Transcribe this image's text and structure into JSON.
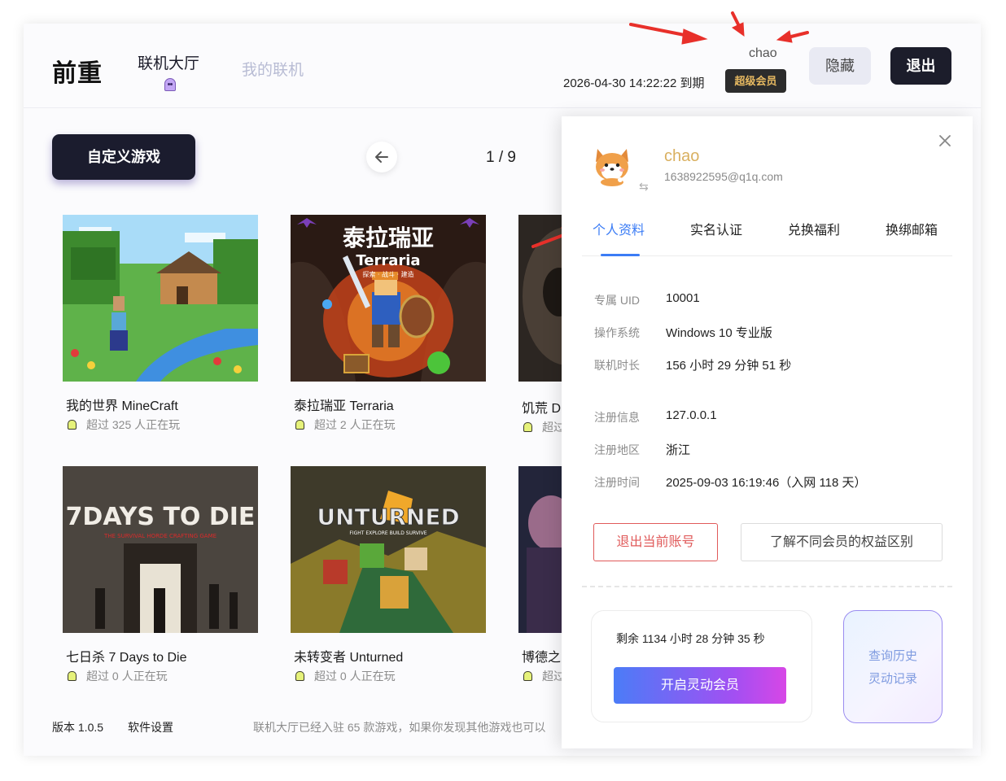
{
  "header": {
    "logo": "前重",
    "tabs": [
      {
        "label": "联机大厅"
      },
      {
        "label": "我的联机"
      }
    ],
    "username": "chao",
    "expire_text": "2026-04-30 14:22:22 到期",
    "vip_badge": "超级会员",
    "hide_label": "隐藏",
    "logout_label": "退出"
  },
  "toolbar": {
    "custom_game_label": "自定义游戏",
    "page_indicator": "1 / 9"
  },
  "games": [
    {
      "title": "我的世界 MineCraft",
      "players": "超过 325 人正在玩"
    },
    {
      "title": "泰拉瑞亚 Terraria",
      "players": "超过 2 人正在玩",
      "art_title": "泰拉瑞亚",
      "art_subtitle": "Terraria",
      "art_tagline": "探索 · 战斗 · 建造"
    },
    {
      "title": "饥荒 D",
      "players": "超过"
    },
    {
      "title": "七日杀 7 Days to Die",
      "players": "超过 0 人正在玩",
      "art_title": "7DAYS TO DIE",
      "art_tagline": "THE SURVIVAL HORDE CRAFTING GAME"
    },
    {
      "title": "未转变者 Unturned",
      "players": "超过 0 人正在玩",
      "art_title": "UNTURNED",
      "art_tagline": "FIGHT EXPLORE BUILD SURVIVE"
    },
    {
      "title": "博德之",
      "players": "超过"
    }
  ],
  "footer": {
    "version": "版本 1.0.5",
    "settings": "软件设置",
    "info": "联机大厅已经入驻 65 款游戏，如果你发现其他游戏也可以"
  },
  "profile": {
    "name": "chao",
    "email": "1638922595@q1q.com",
    "tabs": [
      {
        "label": "个人资料"
      },
      {
        "label": "实名认证"
      },
      {
        "label": "兑换福利"
      },
      {
        "label": "换绑邮箱"
      }
    ],
    "active_tab": "个人资料",
    "info": [
      {
        "label": "专属 UID",
        "value": "10001"
      },
      {
        "label": "操作系统",
        "value": "Windows 10 专业版"
      },
      {
        "label": "联机时长",
        "value": "156 小时 29 分钟 51 秒"
      },
      {
        "label": "注册信息",
        "value": "127.0.0.1"
      },
      {
        "label": "注册地区",
        "value": "浙江"
      },
      {
        "label": "注册时间",
        "value": "2025-09-03 16:19:46（入网 118 天）"
      }
    ],
    "logout_account_label": "退出当前账号",
    "benefits_label": "了解不同会员的权益区别",
    "remaining_text": "剩余 1134 小时 28 分钟 35 秒",
    "open_vip_label": "开启灵动会员",
    "history_line1": "查询历史",
    "history_line2": "灵动记录"
  },
  "colors": {
    "accent_blue": "#3b7cf5",
    "dark_button": "#1c1d2b",
    "vip_gold": "#e7b961",
    "danger": "#e05a5a",
    "annotation_arrow": "#e8302a"
  }
}
